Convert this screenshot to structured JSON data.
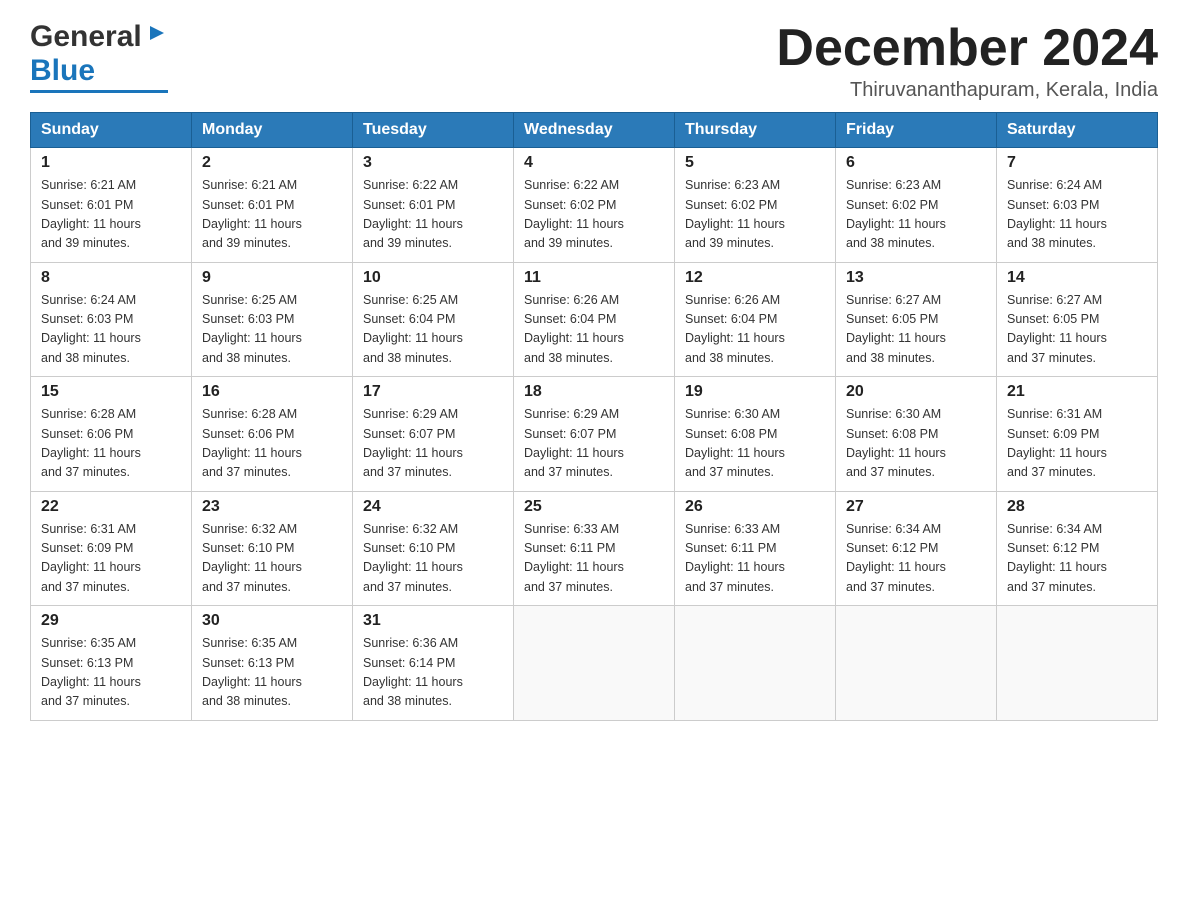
{
  "header": {
    "logo": {
      "general": "General",
      "blue": "Blue",
      "arrow_unicode": "▶"
    },
    "title": "December 2024",
    "location": "Thiruvananthapuram, Kerala, India"
  },
  "calendar": {
    "days_of_week": [
      "Sunday",
      "Monday",
      "Tuesday",
      "Wednesday",
      "Thursday",
      "Friday",
      "Saturday"
    ],
    "weeks": [
      [
        {
          "day": "1",
          "sunrise": "6:21 AM",
          "sunset": "6:01 PM",
          "daylight": "11 hours and 39 minutes."
        },
        {
          "day": "2",
          "sunrise": "6:21 AM",
          "sunset": "6:01 PM",
          "daylight": "11 hours and 39 minutes."
        },
        {
          "day": "3",
          "sunrise": "6:22 AM",
          "sunset": "6:01 PM",
          "daylight": "11 hours and 39 minutes."
        },
        {
          "day": "4",
          "sunrise": "6:22 AM",
          "sunset": "6:02 PM",
          "daylight": "11 hours and 39 minutes."
        },
        {
          "day": "5",
          "sunrise": "6:23 AM",
          "sunset": "6:02 PM",
          "daylight": "11 hours and 39 minutes."
        },
        {
          "day": "6",
          "sunrise": "6:23 AM",
          "sunset": "6:02 PM",
          "daylight": "11 hours and 38 minutes."
        },
        {
          "day": "7",
          "sunrise": "6:24 AM",
          "sunset": "6:03 PM",
          "daylight": "11 hours and 38 minutes."
        }
      ],
      [
        {
          "day": "8",
          "sunrise": "6:24 AM",
          "sunset": "6:03 PM",
          "daylight": "11 hours and 38 minutes."
        },
        {
          "day": "9",
          "sunrise": "6:25 AM",
          "sunset": "6:03 PM",
          "daylight": "11 hours and 38 minutes."
        },
        {
          "day": "10",
          "sunrise": "6:25 AM",
          "sunset": "6:04 PM",
          "daylight": "11 hours and 38 minutes."
        },
        {
          "day": "11",
          "sunrise": "6:26 AM",
          "sunset": "6:04 PM",
          "daylight": "11 hours and 38 minutes."
        },
        {
          "day": "12",
          "sunrise": "6:26 AM",
          "sunset": "6:04 PM",
          "daylight": "11 hours and 38 minutes."
        },
        {
          "day": "13",
          "sunrise": "6:27 AM",
          "sunset": "6:05 PM",
          "daylight": "11 hours and 38 minutes."
        },
        {
          "day": "14",
          "sunrise": "6:27 AM",
          "sunset": "6:05 PM",
          "daylight": "11 hours and 37 minutes."
        }
      ],
      [
        {
          "day": "15",
          "sunrise": "6:28 AM",
          "sunset": "6:06 PM",
          "daylight": "11 hours and 37 minutes."
        },
        {
          "day": "16",
          "sunrise": "6:28 AM",
          "sunset": "6:06 PM",
          "daylight": "11 hours and 37 minutes."
        },
        {
          "day": "17",
          "sunrise": "6:29 AM",
          "sunset": "6:07 PM",
          "daylight": "11 hours and 37 minutes."
        },
        {
          "day": "18",
          "sunrise": "6:29 AM",
          "sunset": "6:07 PM",
          "daylight": "11 hours and 37 minutes."
        },
        {
          "day": "19",
          "sunrise": "6:30 AM",
          "sunset": "6:08 PM",
          "daylight": "11 hours and 37 minutes."
        },
        {
          "day": "20",
          "sunrise": "6:30 AM",
          "sunset": "6:08 PM",
          "daylight": "11 hours and 37 minutes."
        },
        {
          "day": "21",
          "sunrise": "6:31 AM",
          "sunset": "6:09 PM",
          "daylight": "11 hours and 37 minutes."
        }
      ],
      [
        {
          "day": "22",
          "sunrise": "6:31 AM",
          "sunset": "6:09 PM",
          "daylight": "11 hours and 37 minutes."
        },
        {
          "day": "23",
          "sunrise": "6:32 AM",
          "sunset": "6:10 PM",
          "daylight": "11 hours and 37 minutes."
        },
        {
          "day": "24",
          "sunrise": "6:32 AM",
          "sunset": "6:10 PM",
          "daylight": "11 hours and 37 minutes."
        },
        {
          "day": "25",
          "sunrise": "6:33 AM",
          "sunset": "6:11 PM",
          "daylight": "11 hours and 37 minutes."
        },
        {
          "day": "26",
          "sunrise": "6:33 AM",
          "sunset": "6:11 PM",
          "daylight": "11 hours and 37 minutes."
        },
        {
          "day": "27",
          "sunrise": "6:34 AM",
          "sunset": "6:12 PM",
          "daylight": "11 hours and 37 minutes."
        },
        {
          "day": "28",
          "sunrise": "6:34 AM",
          "sunset": "6:12 PM",
          "daylight": "11 hours and 37 minutes."
        }
      ],
      [
        {
          "day": "29",
          "sunrise": "6:35 AM",
          "sunset": "6:13 PM",
          "daylight": "11 hours and 37 minutes."
        },
        {
          "day": "30",
          "sunrise": "6:35 AM",
          "sunset": "6:13 PM",
          "daylight": "11 hours and 38 minutes."
        },
        {
          "day": "31",
          "sunrise": "6:36 AM",
          "sunset": "6:14 PM",
          "daylight": "11 hours and 38 minutes."
        },
        null,
        null,
        null,
        null
      ]
    ],
    "labels": {
      "sunrise": "Sunrise:",
      "sunset": "Sunset:",
      "daylight": "Daylight:"
    }
  }
}
